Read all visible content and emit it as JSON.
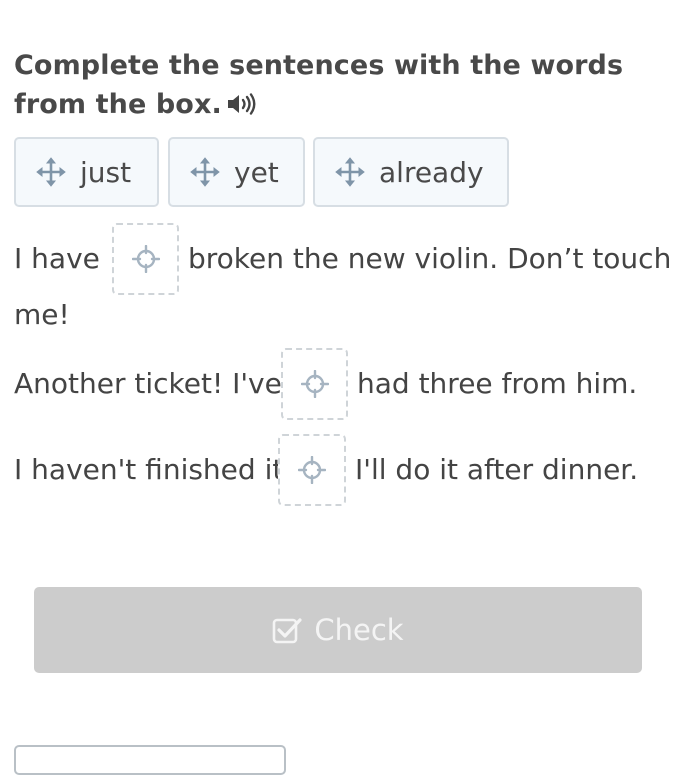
{
  "instruction": {
    "text": "Complete the sentences with the words from the box."
  },
  "word_bank": [
    {
      "label": "just"
    },
    {
      "label": "yet"
    },
    {
      "label": "already"
    }
  ],
  "sentences": [
    {
      "before": "I have",
      "after_line1": "broken the new violin. Don’t touch",
      "after_line2": "me!"
    },
    {
      "before": "Another ticket! I've",
      "after": "had three from him."
    },
    {
      "before": "I haven't finished it",
      "after": "I'll do it after dinner."
    }
  ],
  "check_button": {
    "label": "Check"
  }
}
